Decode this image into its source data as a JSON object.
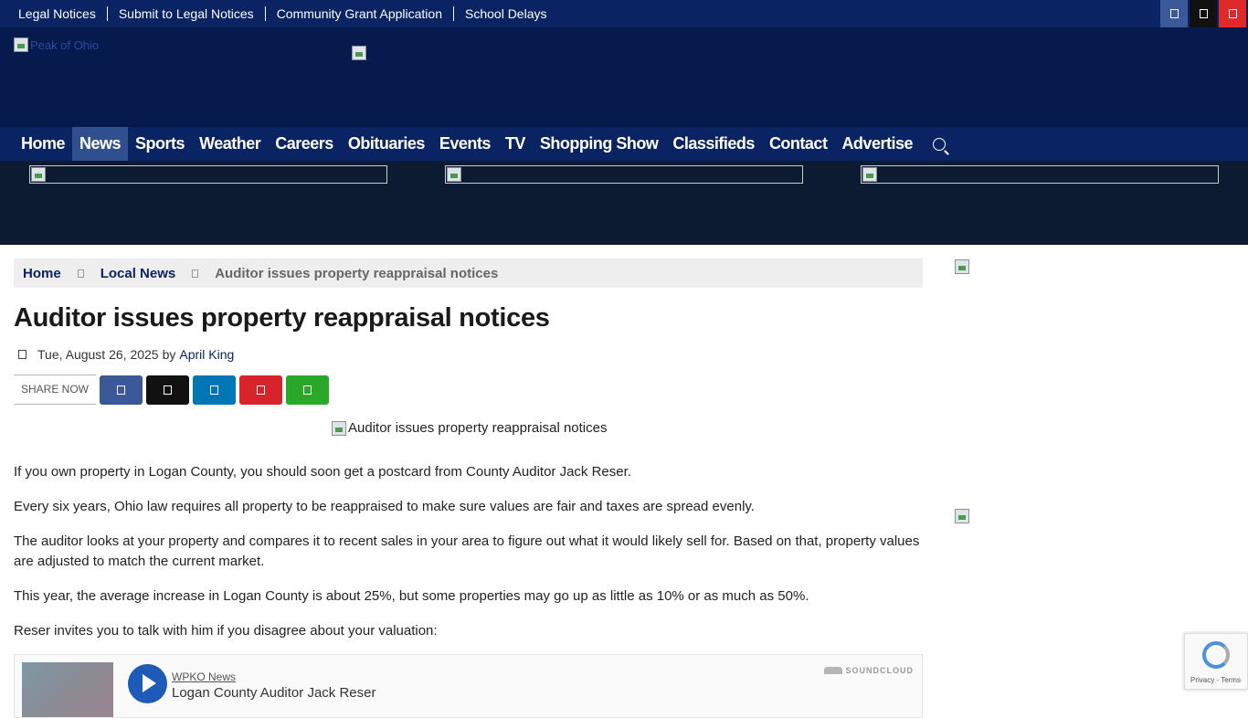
{
  "top_links": [
    "Legal Notices",
    "Submit to Legal Notices",
    "Community Grant Application",
    "School Delays"
  ],
  "top_social": [
    {
      "icon": "facebook-icon",
      "color": "#3b5998"
    },
    {
      "icon": "x-icon",
      "color": "#111111"
    },
    {
      "icon": "youtube-icon",
      "color": "#e02a2a"
    }
  ],
  "header": {
    "logo_alt": "Peak of Ohio"
  },
  "nav": {
    "items": [
      "Home",
      "News",
      "Sports",
      "Weather",
      "Careers",
      "Obituaries",
      "Events",
      "TV",
      "Shopping Show",
      "Classifieds",
      "Contact",
      "Advertise"
    ],
    "active": "News",
    "search_icon": "search-icon"
  },
  "breadcrumb": {
    "home": "Home",
    "section": "Local News",
    "current": "Auditor issues property reappraisal notices"
  },
  "article": {
    "title": "Auditor issues property reappraisal notices",
    "date": "Tue, August 26, 2025",
    "by": "by",
    "author": "April King",
    "share_label": "SHARE NOW",
    "share_buttons": [
      {
        "icon": "facebook-icon",
        "color": "#3b5998"
      },
      {
        "icon": "x-icon",
        "color": "#111111"
      },
      {
        "icon": "linkedin-icon",
        "color": "#0077b5"
      },
      {
        "icon": "pinterest-icon",
        "color": "#d8232a"
      },
      {
        "icon": "whatsapp-icon",
        "color": "#2aa82a"
      }
    ],
    "hero_alt": "Auditor issues property reappraisal notices",
    "paragraphs": [
      "If you own property in Logan County, you should soon get a postcard from County Auditor Jack Reser.",
      "Every six years, Ohio law requires all property to be reappraised to make sure values are fair and taxes are spread evenly.",
      "The auditor looks at your property and compares it to recent sales in your area to figure out what it would likely sell for. Based on that, property values are adjusted to match the current market.",
      "This year, the average increase in Logan County is about 25%, but some properties may go up as little as 10% or as much as 50%.",
      "Reser invites you to talk with him if you disagree about your valuation:"
    ]
  },
  "soundcloud": {
    "user": "WPKO News",
    "track": "Logan County Auditor Jack Reser",
    "brand": "SOUNDCLOUD"
  },
  "recaptcha": {
    "links": "Privacy - Terms"
  }
}
